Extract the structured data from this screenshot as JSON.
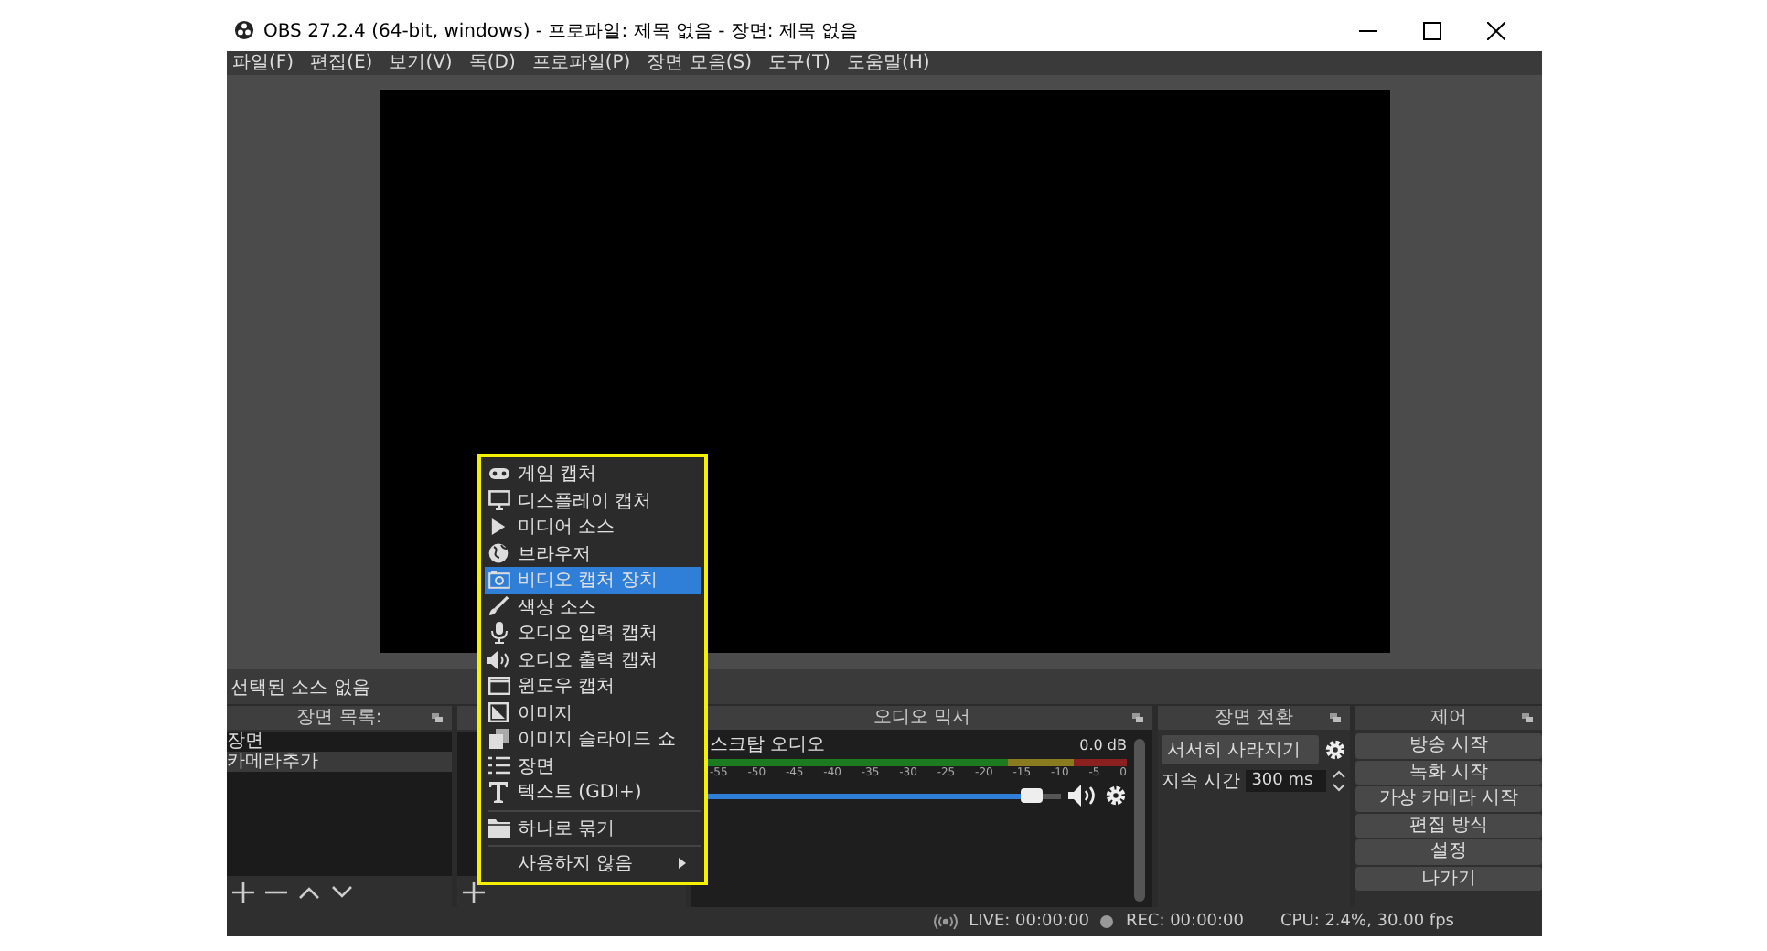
{
  "window": {
    "title": "OBS 27.2.4 (64-bit, windows) - 프로파일: 제목 없음 - 장면: 제목 없음"
  },
  "menu_bar": [
    "파일(F)",
    "편집(E)",
    "보기(V)",
    "독(D)",
    "프로파일(P)",
    "장면 모음(S)",
    "도구(T)",
    "도움말(H)"
  ],
  "source_toolbar": {
    "label": "선택된 소스 없음"
  },
  "scenes_dock": {
    "title": "장면 목록:",
    "items": [
      {
        "label": "장면",
        "selected": false
      },
      {
        "label": "카메라추가",
        "selected": true
      }
    ]
  },
  "audio_mixer": {
    "title": "오디오 믹서",
    "channels": [
      {
        "name": "스크탑 오디오",
        "reading": "0.0 dB",
        "level": 0.95,
        "muted": false,
        "ticks": [
          "-55",
          "-50",
          "-45",
          "-40",
          "-35",
          "-30",
          "-25",
          "-20",
          "-15",
          "-10",
          "-5",
          "0"
        ]
      }
    ]
  },
  "transitions_dock": {
    "title": "장면 전환",
    "transition": "서서히 사라지기",
    "duration_label": "지속 시간",
    "duration": "300 ms"
  },
  "controls_dock": {
    "title": "제어",
    "buttons": [
      "방송 시작",
      "녹화 시작",
      "가상 카메라 시작",
      "편집 방식",
      "설정",
      "나가기"
    ]
  },
  "status_bar": {
    "live": "LIVE: 00:00:00",
    "rec": "REC: 00:00:00",
    "cpu": "CPU: 2.4%, 30.00 fps"
  },
  "context_menu": {
    "items": [
      {
        "kind": "gamepad",
        "label": "게임 캡처",
        "selected": false
      },
      {
        "kind": "monitor",
        "label": "디스플레이 캡처",
        "selected": false
      },
      {
        "kind": "play",
        "label": "미디어 소스",
        "selected": false
      },
      {
        "kind": "globe",
        "label": "브라우저",
        "selected": false
      },
      {
        "kind": "camera",
        "label": "비디오 캡처 장치",
        "selected": true
      },
      {
        "kind": "brush",
        "label": "색상 소스",
        "selected": false
      },
      {
        "kind": "mic",
        "label": "오디오 입력 캡처",
        "selected": false
      },
      {
        "kind": "speaker",
        "label": "오디오 출력 캡처",
        "selected": false
      },
      {
        "kind": "window",
        "label": "윈도우 캡처",
        "selected": false
      },
      {
        "kind": "image",
        "label": "이미지",
        "selected": false
      },
      {
        "kind": "slides",
        "label": "이미지 슬라이드 쇼",
        "selected": false
      },
      {
        "kind": "list",
        "label": "장면",
        "selected": false
      },
      {
        "kind": "text",
        "label": "텍스트 (GDI+)",
        "selected": false
      },
      {
        "kind": "folder",
        "label": "하나로 묶기",
        "selected": false,
        "separator_before": true
      },
      {
        "kind": "none",
        "label": "사용하지 않음",
        "selected": false,
        "separator_before": true,
        "submenu": true
      }
    ]
  }
}
